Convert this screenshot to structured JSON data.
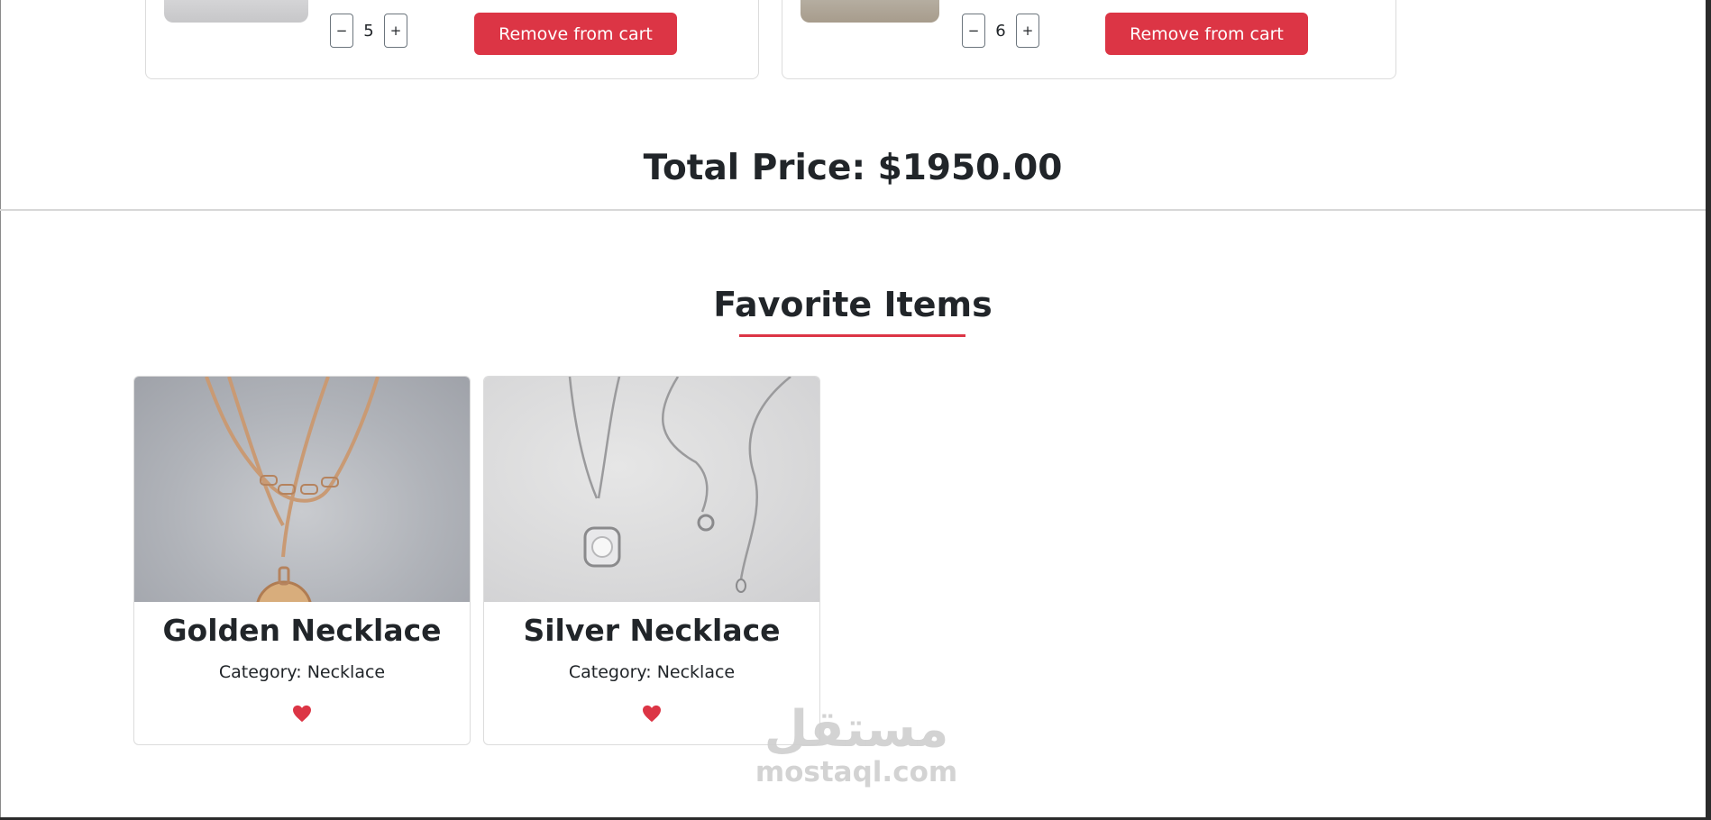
{
  "cart": {
    "items": [
      {
        "quantity": "5",
        "decrement_label": "−",
        "increment_label": "+",
        "remove_label": "Remove from cart"
      },
      {
        "quantity": "6",
        "decrement_label": "−",
        "increment_label": "+",
        "remove_label": "Remove from cart"
      }
    ],
    "total_text": "Total Price: $1950.00"
  },
  "favorites": {
    "heading": "Favorite Items",
    "items": [
      {
        "name": "Golden Necklace",
        "category": "Category: Necklace",
        "icon": "heart-icon"
      },
      {
        "name": "Silver Necklace",
        "category": "Category: Necklace",
        "icon": "heart-icon"
      }
    ]
  },
  "watermark": {
    "script": "مستقل",
    "url": "mostaql.com"
  },
  "colors": {
    "accent": "#dc3545",
    "text": "#212529",
    "border": "#dcdcdc"
  }
}
